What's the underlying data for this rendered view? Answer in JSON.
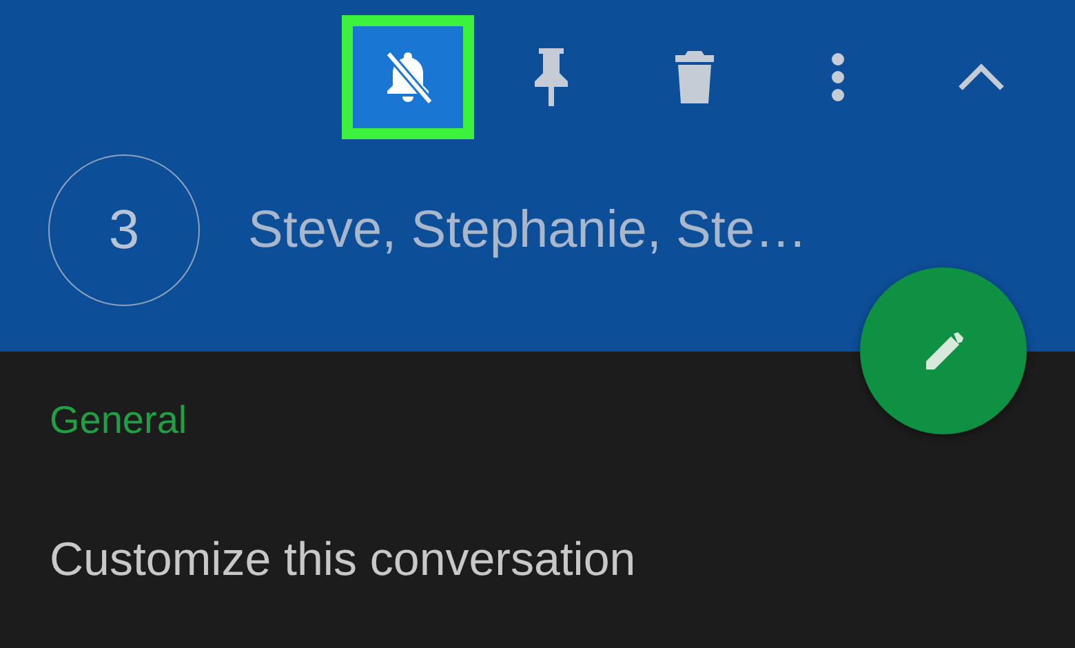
{
  "toolbar": {
    "buttons": [
      {
        "kind": "mute",
        "highlighted": true
      },
      {
        "kind": "pin",
        "highlighted": false
      },
      {
        "kind": "delete",
        "highlighted": false
      },
      {
        "kind": "more",
        "highlighted": false
      },
      {
        "kind": "collapse",
        "highlighted": false
      }
    ]
  },
  "conversation": {
    "avatar": "3",
    "title": "Steve, Stephanie, Ste…"
  },
  "settings": {
    "section": "General",
    "items": [
      "Customize this conversation"
    ]
  }
}
